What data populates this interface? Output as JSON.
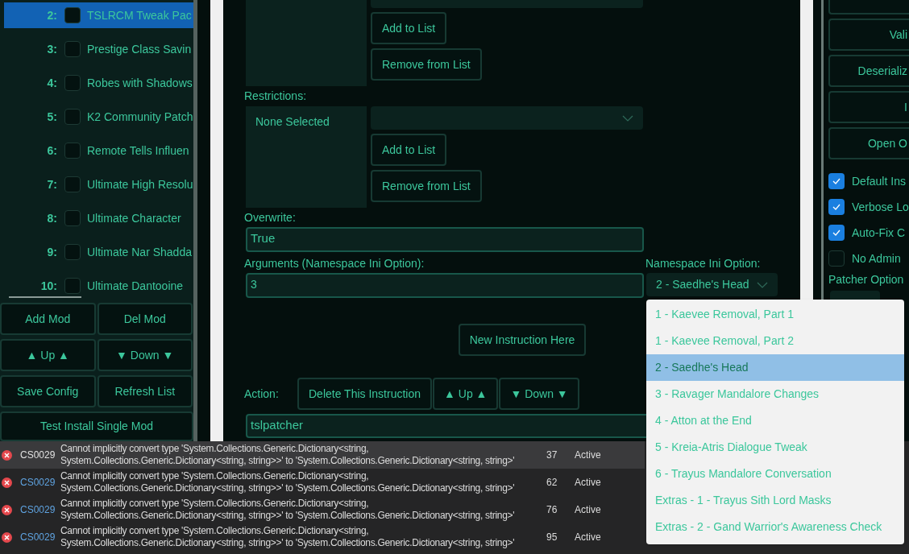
{
  "mod_list": {
    "items": [
      {
        "number": "2:",
        "name": "TSLRCM Tweak Pac",
        "checked": false,
        "selected": true
      },
      {
        "number": "3:",
        "name": "Prestige Class Savin",
        "checked": false,
        "selected": false
      },
      {
        "number": "4:",
        "name": "Robes with Shadows",
        "checked": false,
        "selected": false
      },
      {
        "number": "5:",
        "name": "K2 Community Patch",
        "checked": false,
        "selected": false
      },
      {
        "number": "6:",
        "name": "Remote Tells Influen",
        "checked": false,
        "selected": false
      },
      {
        "number": "7:",
        "name": "Ultimate High Resolu",
        "checked": false,
        "selected": false
      },
      {
        "number": "8:",
        "name": "Ultimate Character",
        "checked": false,
        "selected": false
      },
      {
        "number": "9:",
        "name": "Ultimate Nar Shadda",
        "checked": false,
        "selected": false
      },
      {
        "number": "10:",
        "name": "Ultimate Dantooine",
        "checked": false,
        "selected": false
      }
    ]
  },
  "mod_buttons": [
    "Add Mod",
    "Del Mod",
    "▲ Up ▲",
    "▼ Down ▼",
    "Save Config",
    "Refresh List",
    "Test Install Single Mod"
  ],
  "instruction": {
    "first_list": {
      "buttons": [
        "Add to List",
        "Remove from List"
      ]
    },
    "restrictions": {
      "label": "Restrictions:",
      "value": "None Selected",
      "buttons": [
        "Add to List",
        "Remove from List"
      ]
    },
    "overwrite": {
      "label": "Overwrite:",
      "value": "True"
    },
    "arguments": {
      "label": "Arguments (Namespace Ini Option):",
      "value": "3"
    },
    "namespace": {
      "label": "Namespace Ini Option:",
      "value": "2 - Saedhe's Head",
      "expanded": true,
      "options": [
        {
          "label": "1 - Kaevee Removal, Part 1",
          "selected": false
        },
        {
          "label": "1 - Kaevee Removal, Part 2",
          "selected": false
        },
        {
          "label": "2 - Saedhe's Head",
          "selected": true
        },
        {
          "label": "3 - Ravager Mandalore Changes",
          "selected": false
        },
        {
          "label": "4 - Atton at the End",
          "selected": false
        },
        {
          "label": "5 - Kreia-Atris Dialogue Tweak",
          "selected": false
        },
        {
          "label": "6 - Trayus Mandalore Conversation",
          "selected": false
        },
        {
          "label": "Extras - 1 - Trayus Sith Lord Masks",
          "selected": false
        },
        {
          "label": "Extras - 2 - Gand Warrior's Awareness Check",
          "selected": false
        }
      ]
    },
    "new_button": "New Instruction Here",
    "action": {
      "label": "Action:",
      "buttons": [
        "Delete This Instruction",
        "▲ Up ▲",
        "▼ Down ▼"
      ],
      "value": "tslpatcher"
    }
  },
  "right_panel": {
    "buttons": [
      "Vali",
      "Deserializ",
      "I",
      "Open O"
    ],
    "checkboxes": [
      {
        "label": "Default Ins",
        "checked": true
      },
      {
        "label": "Verbose Lo",
        "checked": true
      },
      {
        "label": "Auto-Fix C",
        "checked": true
      },
      {
        "label": "No Admin",
        "checked": false
      }
    ],
    "options_label": "Patcher Option"
  },
  "error_list": {
    "rows": [
      {
        "code": "CS0029",
        "message": [
          "Cannot implicitly convert type 'System.Collections.Generic.Dictionary<string,",
          "System.Collections.Generic.Dictionary<string, string>>' to 'System.Collections.Generic.Dictionary<string, string>'"
        ],
        "line": "37",
        "state": "Active",
        "selected": true
      },
      {
        "code": "CS0029",
        "message": [
          "Cannot implicitly convert type 'System.Collections.Generic.Dictionary<string,",
          "System.Collections.Generic.Dictionary<string, string>>' to 'System.Collections.Generic.Dictionary<string, string>'"
        ],
        "line": "62",
        "state": "Active",
        "selected": false
      },
      {
        "code": "CS0029",
        "message": [
          "Cannot implicitly convert type 'System.Collections.Generic.Dictionary<string,",
          "System.Collections.Generic.Dictionary<string, string>>' to 'System.Collections.Generic.Dictionary<string, string>'"
        ],
        "line": "76",
        "state": "Active",
        "selected": false
      },
      {
        "code": "CS0029",
        "message": [
          "Cannot implicitly convert type 'System.Collections.Generic.Dictionary<string,",
          "System.Collections.Generic.Dictionary<string, string>>' to 'System.Collections.Generic.Dictionary<string, string>'"
        ],
        "line": "95",
        "state": "Active",
        "selected": false
      }
    ]
  }
}
